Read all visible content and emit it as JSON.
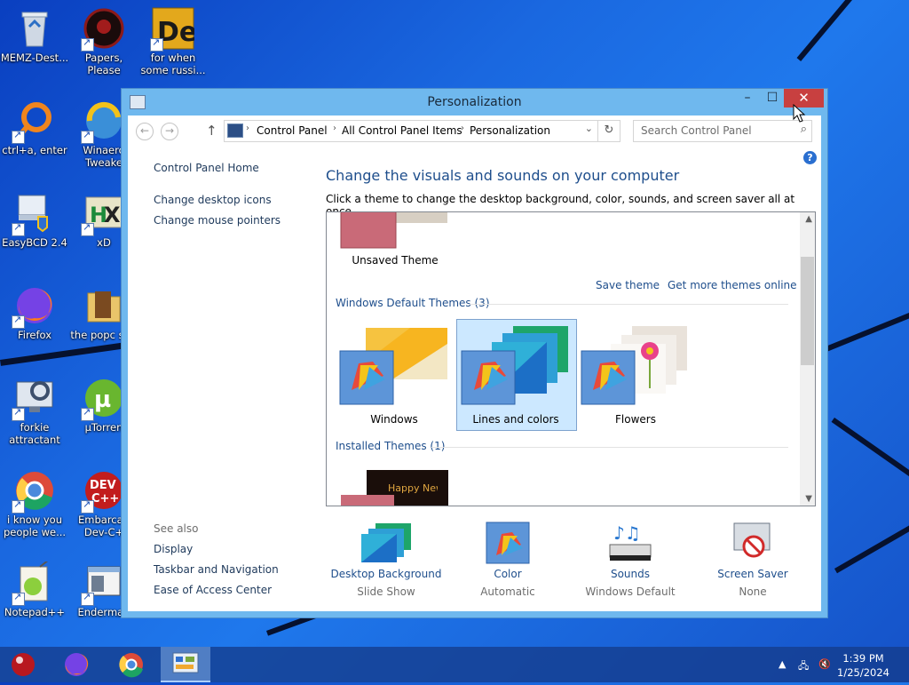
{
  "desktop": {
    "icons": [
      {
        "label": "MEMZ-Dest..."
      },
      {
        "label": "Papers, Please"
      },
      {
        "label": "for when some russi..."
      },
      {
        "label": "ctrl+a, enter"
      },
      {
        "label": "Winaero Tweake"
      },
      {
        "label": "EasyBCD 2.4"
      },
      {
        "label": "xD"
      },
      {
        "label": "Firefox"
      },
      {
        "label": "the popc shit"
      },
      {
        "label": "forkie attractant"
      },
      {
        "label": "µTorren"
      },
      {
        "label": "i know you people we..."
      },
      {
        "label": "Embarcad Dev-C+"
      },
      {
        "label": "Notepad++"
      },
      {
        "label": "Enderman"
      }
    ]
  },
  "window": {
    "title": "Personalization",
    "controls": {
      "minimize": "–",
      "maximize": "☐",
      "close": "✕"
    },
    "address": {
      "crumbs": [
        "Control Panel",
        "All Control Panel Items",
        "Personalization"
      ],
      "search_placeholder": "Search Control Panel"
    },
    "sidebar": {
      "home": "Control Panel Home",
      "links": [
        "Change desktop icons",
        "Change mouse pointers"
      ],
      "see_also_title": "See also",
      "see_also": [
        "Display",
        "Taskbar and Navigation",
        "Ease of Access Center"
      ]
    },
    "main": {
      "heading": "Change the visuals and sounds on your computer",
      "subheading": "Click a theme to change the desktop background, color, sounds, and screen saver all at once.",
      "unsaved_theme": "Unsaved Theme",
      "save_theme": "Save theme",
      "get_more": "Get more themes online",
      "default_group": "Windows Default Themes (3)",
      "themes": [
        "Windows",
        "Lines and colors",
        "Flowers"
      ],
      "installed_group": "Installed Themes (1)",
      "installed_preview_text": "Happy New Year!"
    },
    "bottom": [
      {
        "title": "Desktop Background",
        "value": "Slide Show"
      },
      {
        "title": "Color",
        "value": "Automatic"
      },
      {
        "title": "Sounds",
        "value": "Windows Default"
      },
      {
        "title": "Screen Saver",
        "value": "None"
      }
    ]
  },
  "taskbar": {
    "time": "1:39 PM",
    "date": "1/25/2024"
  },
  "colors": {
    "link": "#1e4e8c",
    "desktop": "#1a68e0",
    "close_button": "#c84040",
    "selection": "#cce8ff"
  }
}
